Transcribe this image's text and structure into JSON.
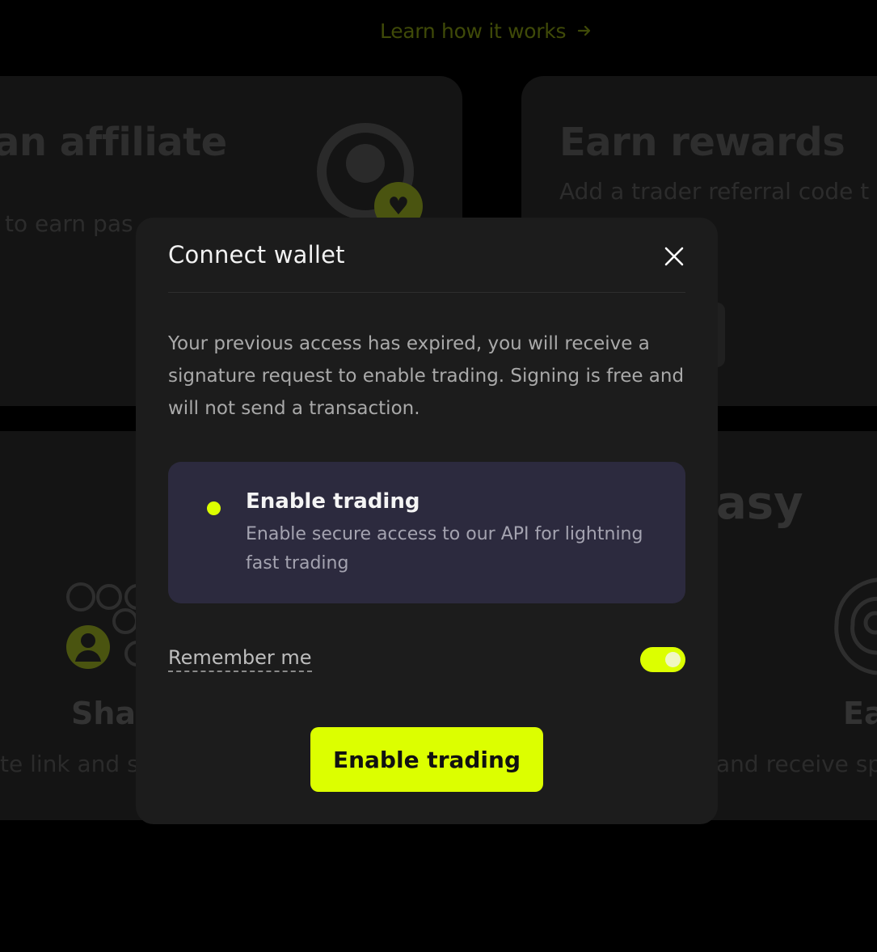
{
  "background": {
    "learn_link": "Learn how it works",
    "arrow_icon": "arrow-right-icon",
    "affiliate_title": "an affiliate",
    "affiliate_sub": "to earn pas",
    "rewards_title": "Earn rewards",
    "rewards_sub": "Add a trader referral code t",
    "easy_title": "asy",
    "share_title": "Shar",
    "share_sub": "te link and sha",
    "ea_title": "Ea",
    "right_sub": "and receive spe"
  },
  "modal": {
    "title": "Connect wallet",
    "close_icon": "close-icon",
    "description": "Your previous access has expired, you will receive a signature request to enable trading. Signing is free and will not send a transaction.",
    "option": {
      "title": "Enable trading",
      "subtitle": "Enable secure access to our API for lightning fast trading"
    },
    "remember_label": "Remember me",
    "remember_enabled": true,
    "primary_button": "Enable trading"
  },
  "colors": {
    "accent": "#dcff00",
    "modal_bg": "#1c1c1c",
    "option_bg": "#2c2a3e"
  }
}
